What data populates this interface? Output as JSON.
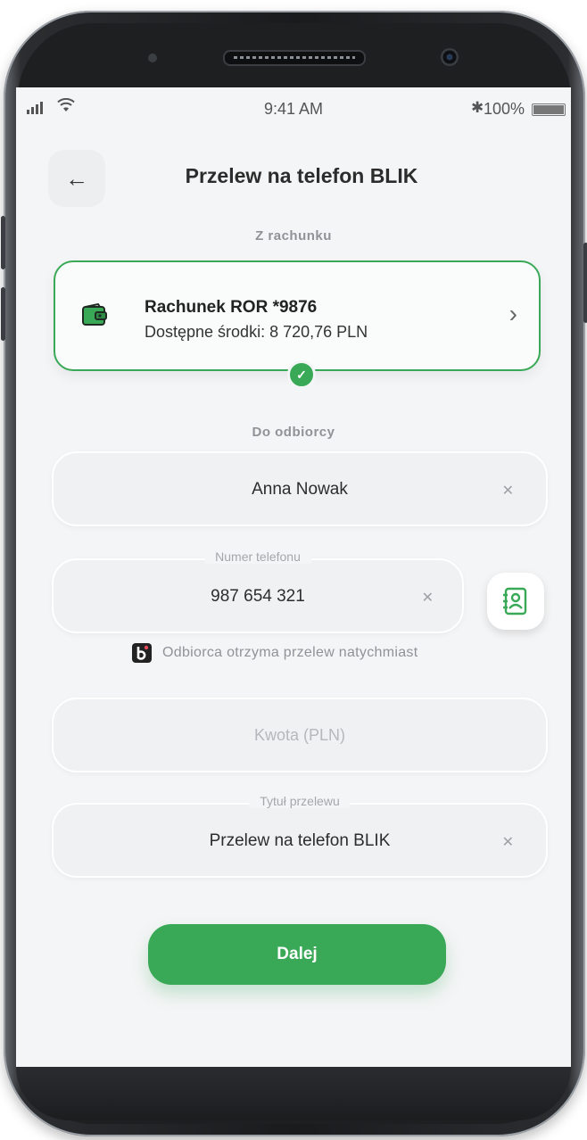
{
  "status_bar": {
    "time": "9:41 AM",
    "battery_percent": "100%"
  },
  "header": {
    "back_icon": "arrow-left-icon",
    "title": "Przelew na telefon BLIK"
  },
  "from_section": {
    "label": "Z rachunku",
    "account": {
      "name": "Rachunek ROR *9876",
      "balance": "Dostępne środki: 8 720,76 PLN"
    }
  },
  "to_section": {
    "label": "Do odbiorcy",
    "recipient_name": "Anna Nowak",
    "phone_label": "Numer telefonu",
    "phone_value": "987 654 321",
    "blik_note": "Odbiorca otrzyma przelew natychmiast",
    "amount_placeholder": "Kwota (PLN)",
    "title_label": "Tytuł przelewu",
    "title_value": "Przelew na telefon BLIK"
  },
  "actions": {
    "next_label": "Dalej"
  },
  "colors": {
    "accent": "#39a957",
    "background": "#f4f5f6"
  }
}
